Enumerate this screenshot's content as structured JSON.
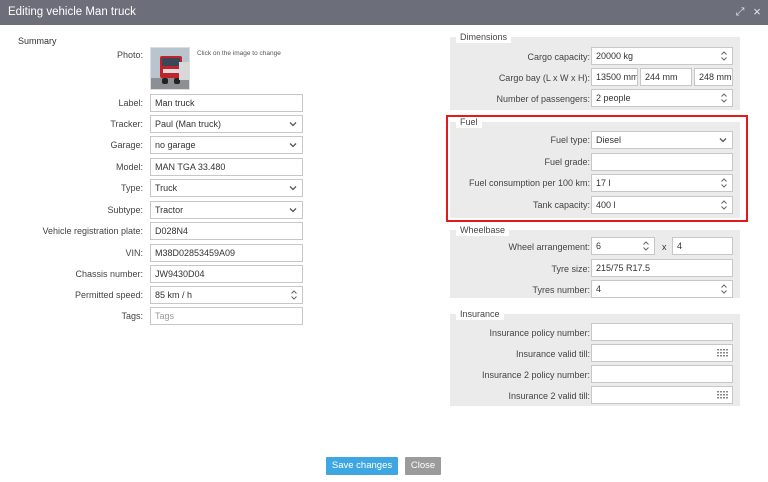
{
  "window": {
    "title": "Editing vehicle Man truck"
  },
  "summary": {
    "section_title": "Summary",
    "photo_label": "Photo:",
    "photo_hint": "Click on the image to change",
    "label_label": "Label:",
    "label_value": "Man truck",
    "tracker_label": "Tracker:",
    "tracker_value": "Paul (Man truck)",
    "garage_label": "Garage:",
    "garage_value": "no garage",
    "model_label": "Model:",
    "model_value": "MAN TGA 33.480",
    "type_label": "Type:",
    "type_value": "Truck",
    "subtype_label": "Subtype:",
    "subtype_value": "Tractor",
    "plate_label": "Vehicle registration plate:",
    "plate_value": "D028N4",
    "vin_label": "VIN:",
    "vin_value": "M38D02853459A09",
    "chassis_label": "Chassis number:",
    "chassis_value": "JW9430D04",
    "speed_label": "Permitted speed:",
    "speed_value": "85  km / h",
    "tags_label": "Tags:",
    "tags_placeholder": "Tags"
  },
  "dimensions": {
    "legend": "Dimensions",
    "cargo_capacity_label": "Cargo capacity:",
    "cargo_capacity_value": "20000  kg",
    "cargo_bay_label": "Cargo bay (L x W x H):",
    "cargo_bay_l": "13500  mm",
    "cargo_bay_w": "244  mm",
    "cargo_bay_h": "248  mm",
    "passengers_label": "Number of passengers:",
    "passengers_value": "2  people"
  },
  "fuel": {
    "legend": "Fuel",
    "type_label": "Fuel type:",
    "type_value": "Diesel",
    "grade_label": "Fuel grade:",
    "grade_value": "",
    "consumption_label": "Fuel consumption per 100 km:",
    "consumption_value": "17  l",
    "tank_label": "Tank capacity:",
    "tank_value": "400  l"
  },
  "wheelbase": {
    "legend": "Wheelbase",
    "arrangement_label": "Wheel arrangement:",
    "arrangement_a": "6",
    "arrangement_sep": "x",
    "arrangement_b": "4",
    "tyre_size_label": "Tyre size:",
    "tyre_size_value": "215/75 R17.5",
    "tyres_number_label": "Tyres number:",
    "tyres_number_value": "4"
  },
  "insurance": {
    "legend": "Insurance",
    "policy_label": "Insurance policy number:",
    "policy_value": "",
    "valid_label": "Insurance valid till:",
    "valid_value": "",
    "policy2_label": "Insurance 2 policy number:",
    "policy2_value": "",
    "valid2_label": "Insurance 2 valid till:",
    "valid2_value": ""
  },
  "buttons": {
    "save": "Save changes",
    "close": "Close"
  },
  "colors": {
    "titlebar": "#6c6f7a",
    "save": "#3ea6e0",
    "close": "#9b9b9b",
    "highlight": "#e11b1b",
    "group_bg": "#ebebeb"
  }
}
